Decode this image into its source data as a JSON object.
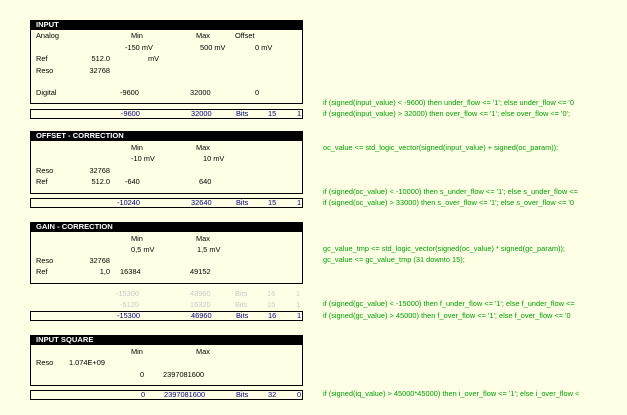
{
  "input": {
    "title": "INPUT",
    "col_min": "Min",
    "col_max": "Max",
    "col_offset": "Offset",
    "analog": "Analog",
    "analog_min": "-150 mV",
    "analog_max": "500 mV",
    "analog_offset": "0 mV",
    "ref_label": "Ref",
    "ref_value": "512.0",
    "ref_unit": "mV",
    "reso_label": "Reso",
    "reso_value": "32768",
    "digital_label": "Digital",
    "digital_min": "-9600",
    "digital_max": "32000",
    "digital_offset": "0",
    "sum_min": "-9600",
    "sum_max": "32000",
    "sum_bits_label": "Bits",
    "sum_bits": "15",
    "sum_sign": "1"
  },
  "offset": {
    "title": "OFFSET - CORRECTION",
    "col_min": "Min",
    "col_max": "Max",
    "min_mv": "-10 mV",
    "max_mv": "10 mV",
    "reso_label": "Reso",
    "reso_value": "32768",
    "ref_label": "Ref",
    "ref_value": "512.0",
    "digital_min": "-640",
    "digital_max": "640",
    "sum_min": "-10240",
    "sum_max": "32640",
    "sum_bits_label": "Bits",
    "sum_bits": "15",
    "sum_sign": "1"
  },
  "gain": {
    "title": "GAIN - CORRECTION",
    "col_min": "Min",
    "col_max": "Max",
    "min_mv": "0,5 mV",
    "max_mv": "1,5 mV",
    "reso_label": "Reso",
    "reso_value": "32768",
    "ref_label": "Ref",
    "ref_value": "1,0",
    "digital_min": "16384",
    "digital_max": "49152",
    "faded1_min": "-15300",
    "faded1_max": "48960",
    "faded1_bits_label": "Bits",
    "faded1_bits": "16",
    "faded1_sign": "1",
    "faded2_min": "-5120",
    "faded2_max": "16320",
    "faded2_bits_label": "Bits",
    "faded2_bits": "15",
    "faded2_sign": "1",
    "sum_min": "-15300",
    "sum_max": "46960",
    "sum_bits_label": "Bits",
    "sum_bits": "16",
    "sum_sign": "1"
  },
  "square": {
    "title": "INPUT SQUARE",
    "col_min": "Min",
    "col_max": "Max",
    "reso_label": "Reso",
    "reso_value": "1.074E+09",
    "row_min": "0",
    "row_max": "2397081600",
    "sum_min": "0",
    "sum_max": "2397081600",
    "sum_bits_label": "Bits",
    "sum_bits": "32",
    "sum_sign": "0"
  },
  "code": {
    "line1": "if (signed(input_value) < -9600) then under_flow <= '1'; else under_flow <= '0",
    "line2": "if (signed(input_value) > 32000) then over_flow <= '1'; else over_flow <= '0';",
    "line3": "oc_value <= std_logic_vector(signed(input_value) + signed(oc_param));",
    "line4": "if (signed(oc_value) < -10000) then s_under_flow <= '1'; else s_under_flow <=",
    "line5": "if (signed(oc_value) > 33000) then s_over_flow <= '1'; else s_over_flow <= '0",
    "line6": "gc_value_tmp <= std_logic_vector(signed(oc_value) * signed(gc_param));",
    "line7": "gc_value <= gc_value_tmp (31 downto 15);",
    "line8": "if (signed(gc_value) < -15000) then f_under_flow <= '1'; else f_under_flow <=",
    "line9": "if (signed(gc_value) > 45000) then f_over_flow <= '1'; else f_over_flow <= '0",
    "line10": "if (signed(iq_value) > 45000*45000) then i_over_flow <= '1'; else i_over_flow <"
  }
}
